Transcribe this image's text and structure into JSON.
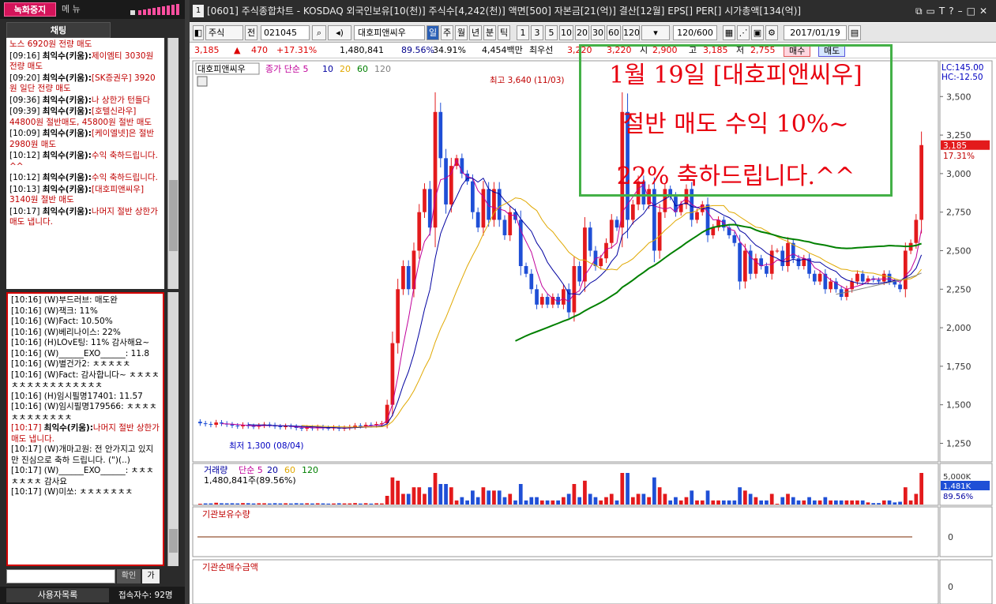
{
  "left": {
    "record_label": "녹화중지",
    "menu_label": "메 뉴",
    "chat_tab": "채팅",
    "notice_msgs": [
      {
        "text": "노스 6920원 전량 매도",
        "red": true
      },
      {
        "time": "[09:16]",
        "name": "최익수(키움):",
        "text": "제이엠티 3030원 전량 매도"
      },
      {
        "time": "[09:20]",
        "name": "최익수(키움):",
        "text": "[SK증권우] 3920원 일단 전량 매도"
      },
      {
        "time": "[09:36]",
        "name": "최익수(키움):",
        "text": "나 상한가 턴들다"
      },
      {
        "time": "[09:39]",
        "name": "최익수(키움):",
        "text": "[호텔신라우] 44800원 절반매도, 45800원 절반 매도"
      },
      {
        "time": "[10:09]",
        "name": "최익수(키움):",
        "text": "[케이엘넷]은 절반 2980원 매도"
      },
      {
        "time": "[10:12]",
        "name": "최익수(키움):",
        "text": "수익 축하드립니다. ^^"
      },
      {
        "time": "[10:12]",
        "name": "최익수(키움):",
        "text": "수익 축하드립니다."
      },
      {
        "time": "[10:13]",
        "name": "최익수(키움):",
        "text": "[대호피앤씨우] 3140원 절반 매도"
      },
      {
        "time": "[10:17]",
        "name": "최익수(키움):",
        "text": "나머지 절반 상한가 매도 냅니다."
      }
    ],
    "chat_msgs": [
      {
        "text": "[10:16] (W)부드러브: 매도완"
      },
      {
        "text": "[10:16] (W)잭크: 11%"
      },
      {
        "text": "[10:16] (W)Fact: 10.50%"
      },
      {
        "text": "[10:16] (W)베리나이스: 22%"
      },
      {
        "text": "[10:16] (H)LOvE팅: 11% 감사해요~"
      },
      {
        "text": "[10:16] (W)______EXO______: 11.8"
      },
      {
        "text": "[10:16] (W)별건가2: ㅊㅊㅊㅊㅊ"
      },
      {
        "text": "[10:16] (W)Fact: 감사합니다~ ㅊㅊㅊㅊㅊㅊㅊㅊㅊㅊㅊㅊㅊㅊㅊㅊ"
      },
      {
        "text": "[10:16] (H)임시필명17401: 11.57"
      },
      {
        "text": "[10:16] (W)임시필명179566: ㅊㅊㅊㅊㅊㅊㅊㅊㅊㅊㅊㅊ"
      },
      {
        "time": "[10:17]",
        "name": "최익수(키움):",
        "text": "나머지 절반 상한가 매도 냅니다.",
        "red": true
      },
      {
        "text": "[10:17] (W)개마고원: 전 안가지고 있지만 진심으로 축하 드립니다. (\")(..)"
      },
      {
        "text": "[10:17] (W)______EXO______: ㅊㅊㅊㅊㅊㅊㅊ 감사요"
      },
      {
        "text": "[10:17] (W)미쏘: ㅊㅊㅊㅊㅊㅊㅊ"
      }
    ],
    "confirm_label": "확인",
    "ga_label": "가",
    "userlist_label": "사용자목록",
    "conn_label": "접속자수: 92명"
  },
  "title": {
    "num": "1",
    "text": "[0601] 주식종합차트 - KOSDAQ 외국인보유[10(천)] 주식수[4,242(천)] 액면[500] 자본금[21(억)] 결산[12월] EPS[] PER[] 시가총액[134(억)]"
  },
  "toolbar": {
    "type": "주식",
    "prev": "전",
    "code": "021045",
    "name": "대호피앤씨우",
    "periods": [
      "일",
      "주",
      "월",
      "년",
      "분",
      "틱"
    ],
    "active_period": "일",
    "nums": [
      "1",
      "3",
      "5",
      "10",
      "20",
      "30",
      "60",
      "120"
    ],
    "count": "120/600",
    "date": "2017/01/19"
  },
  "info": {
    "price": "3,185",
    "up_arrow": "▲",
    "change": "470",
    "change_pct": "+17.31%",
    "volume": "1,480,841",
    "vol_pct": "89.56%",
    "turn": "34.91%",
    "amount": "4,454백만",
    "pref": "최우선",
    "ask": "3,220",
    "bid": "3,220",
    "open_lbl": "시",
    "open": "2,900",
    "high_lbl": "고",
    "high": "3,185",
    "low_lbl": "저",
    "low": "2,755",
    "buy": "매수",
    "sell": "매도"
  },
  "overlay": {
    "line1": "1월 19일 [대호피앤씨우]",
    "line2": "절반 매도 수익 10%~",
    "line3": "22% 축하드립니다.^^"
  },
  "chart_data": [
    {
      "type": "candlestick",
      "title": "대호피앤씨우",
      "legend": [
        "종가 단순 5",
        "10",
        "20",
        "60",
        "120"
      ],
      "legend_colors": [
        "#c0009a",
        "#0000a0",
        "#e0a800",
        "#008000",
        "#808080"
      ],
      "ylim": [
        1150,
        3650
      ],
      "yticks": [
        "3,500",
        "3,250",
        "3,000",
        "2,750",
        "2,500",
        "2,250",
        "2,000",
        "1,750",
        "1,500",
        "1,250"
      ],
      "ytick_values": [
        3500,
        3250,
        3000,
        2750,
        2500,
        2250,
        2000,
        1750,
        1500,
        1250
      ],
      "max_label": "최고 3,640 (11/03)",
      "min_label": "최저 1,300 (08/04)",
      "lc_label": "LC:145.00",
      "hc_label": "HC:-12.50",
      "last_price": "3,185",
      "last_pct": "17.31%",
      "closes": [
        1380,
        1375,
        1370,
        1385,
        1378,
        1372,
        1365,
        1360,
        1370,
        1362,
        1358,
        1365,
        1372,
        1368,
        1360,
        1355,
        1362,
        1358,
        1350,
        1345,
        1352,
        1348,
        1355,
        1350,
        1348,
        1352,
        1345,
        1350,
        1355,
        1365,
        1362,
        1370,
        1368,
        1375,
        1380,
        1500,
        1900,
        2250,
        2400,
        2250,
        2500,
        2750,
        2900,
        2650,
        3400,
        3100,
        2800,
        3050,
        3100,
        3000,
        2950,
        2750,
        2650,
        2900,
        2700,
        2900,
        2700,
        2600,
        2750,
        2700,
        2400,
        2350,
        2250,
        2150,
        2200,
        2150,
        2200,
        2150,
        2250,
        2100,
        2400,
        2300,
        2650,
        2500,
        2400,
        2450,
        2550,
        2700,
        2650,
        3400,
        2700,
        2800,
        2950,
        2800,
        2900,
        2500,
        2750,
        2900,
        2850,
        2750,
        2800,
        2900,
        2700,
        2750,
        2800,
        2600,
        2650,
        2700,
        2650,
        2600,
        2550,
        2300,
        2500,
        2350,
        2450,
        2400,
        2350,
        2500,
        2500,
        2400,
        2550,
        2450,
        2400,
        2450,
        2350,
        2300,
        2350,
        2250,
        2300,
        2250,
        2200,
        2250,
        2300,
        2350,
        2300,
        2320,
        2310,
        2300,
        2350,
        2300,
        2280,
        2250,
        2500,
        2550,
        2700,
        3185
      ],
      "volume_label": "거래량",
      "volume_legend": [
        "단순 5",
        "20",
        "60",
        "120"
      ],
      "volume_value": "1,480,841주(89.56%)",
      "vol_ticks": [
        "5,000K",
        "1,481K",
        "89.56%"
      ],
      "sub1_title": "기관보유수량",
      "sub1_tick": "0",
      "sub2_title": "기관순매수금액",
      "sub2_tick": "0"
    }
  ]
}
